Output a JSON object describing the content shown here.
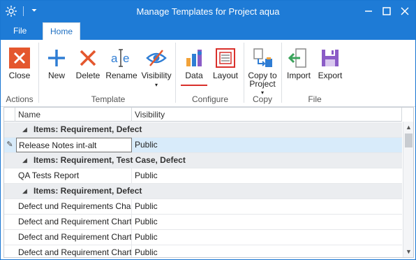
{
  "window": {
    "title": "Manage Templates for Project aqua"
  },
  "quick_access": {
    "menu_glyph": "⏷"
  },
  "tabs": [
    {
      "label": "File"
    },
    {
      "label": "Home"
    }
  ],
  "ribbon": {
    "groups": [
      {
        "label": "Actions"
      },
      {
        "label": "Template"
      },
      {
        "label": "Configure"
      },
      {
        "label": "Copy"
      },
      {
        "label": "File"
      }
    ],
    "buttons": {
      "close": "Close",
      "new": "New",
      "delete": "Delete",
      "rename": "Rename",
      "visibility": "Visibility",
      "data": "Data",
      "layout": "Layout",
      "copy_line1": "Copy to",
      "copy_line2": "Project",
      "import": "Import",
      "export": "Export"
    },
    "dropdown_caret": "▾"
  },
  "grid": {
    "columns": {
      "name": "Name",
      "visibility": "Visibility"
    },
    "rows": [
      {
        "type": "group",
        "text": "Items: Requirement, Defect"
      },
      {
        "type": "data",
        "name": "Release Notes int-alt",
        "visibility": "Public",
        "editing": true
      },
      {
        "type": "group",
        "text": "Items: Requirement, Test Case, Defect"
      },
      {
        "type": "data",
        "name": "QA Tests Report",
        "visibility": "Public"
      },
      {
        "type": "group",
        "text": "Items: Requirement, Defect"
      },
      {
        "type": "data",
        "name": "Defect und Requirements Chart...",
        "visibility": "Public"
      },
      {
        "type": "data",
        "name": "Defect and Requirement Chart...",
        "visibility": "Public"
      },
      {
        "type": "data",
        "name": "Defect and Requirement Chart...",
        "visibility": "Public"
      },
      {
        "type": "data",
        "name": "Defect and Requirement Chart...",
        "visibility": "Public"
      }
    ],
    "row_edit_indicator": "✎",
    "group_expander": "◢"
  },
  "colors": {
    "titlebar": "#1e7bd6",
    "accent_red": "#d9302b",
    "selected_row": "#d8ebfa"
  }
}
